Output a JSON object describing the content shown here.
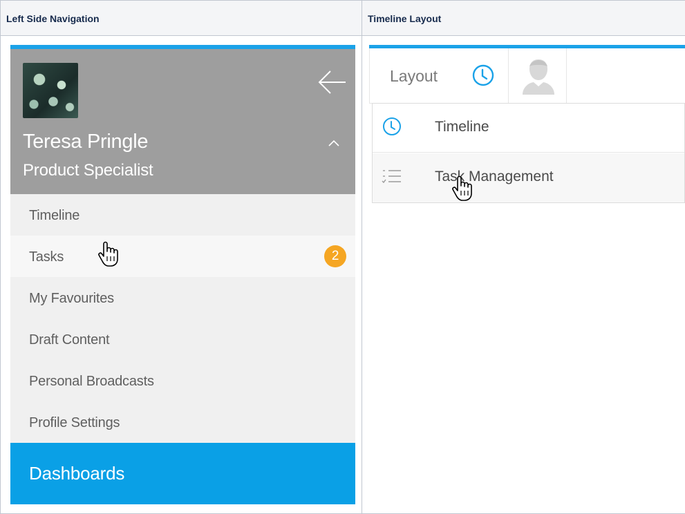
{
  "headers": {
    "left": "Left Side Navigation",
    "right": "Timeline Layout"
  },
  "profile": {
    "name": "Teresa Pringle",
    "role": "Product Specialist"
  },
  "nav": {
    "items": [
      {
        "label": "Timeline"
      },
      {
        "label": "Tasks",
        "badge": "2"
      },
      {
        "label": "My Favourites"
      },
      {
        "label": "Draft Content"
      },
      {
        "label": "Personal Broadcasts"
      },
      {
        "label": "Profile Settings"
      }
    ],
    "dashboards_label": "Dashboards"
  },
  "layout_panel": {
    "layout_label": "Layout",
    "options": [
      {
        "label": "Timeline",
        "icon": "clock-icon"
      },
      {
        "label": "Task Management",
        "icon": "checklist-icon"
      }
    ]
  },
  "colors": {
    "accent_blue": "#0aa0e6",
    "badge_orange": "#f5a623",
    "profile_gray": "#9e9e9e",
    "nav_bg": "#f0f0f0"
  }
}
